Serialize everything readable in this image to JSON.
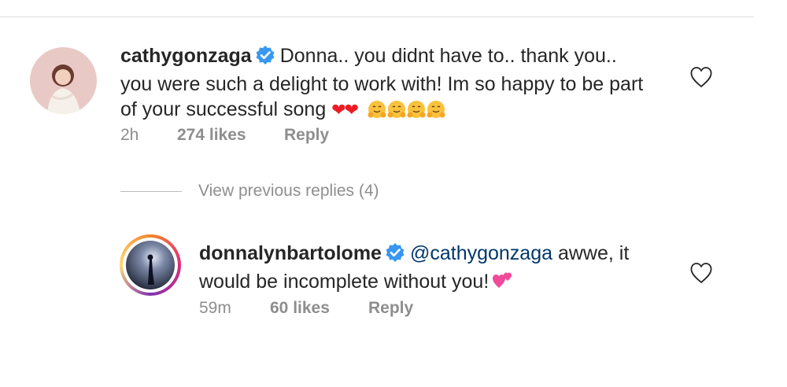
{
  "comments": [
    {
      "username": "cathygonzaga",
      "text_line1": "Donna.. you didnt have to.. thank you..",
      "text_line2": "you were such a delight to work with! Im so happy to be part",
      "text_line3": "of your successful song",
      "hearts": "❤❤",
      "time": "2h",
      "likes": "274 likes",
      "reply": "Reply",
      "verified_icon": "verified-badge-icon",
      "like_icon": "heart-outline-icon"
    },
    {
      "username": "donnalynbartolome",
      "mention": "@cathygonzaga",
      "text_line1_rest": " awwe, it",
      "text_line2": "would be incomplete without you!",
      "time": "59m",
      "likes": "60 likes",
      "reply": "Reply",
      "verified_icon": "verified-badge-icon",
      "like_icon": "heart-outline-icon"
    }
  ],
  "view_previous_replies": "View previous replies (4)",
  "colors": {
    "text": "#262626",
    "muted": "#8e8e8e",
    "verified": "#3897f0",
    "mention": "#00376b",
    "heart_red": "#ed1c24"
  }
}
